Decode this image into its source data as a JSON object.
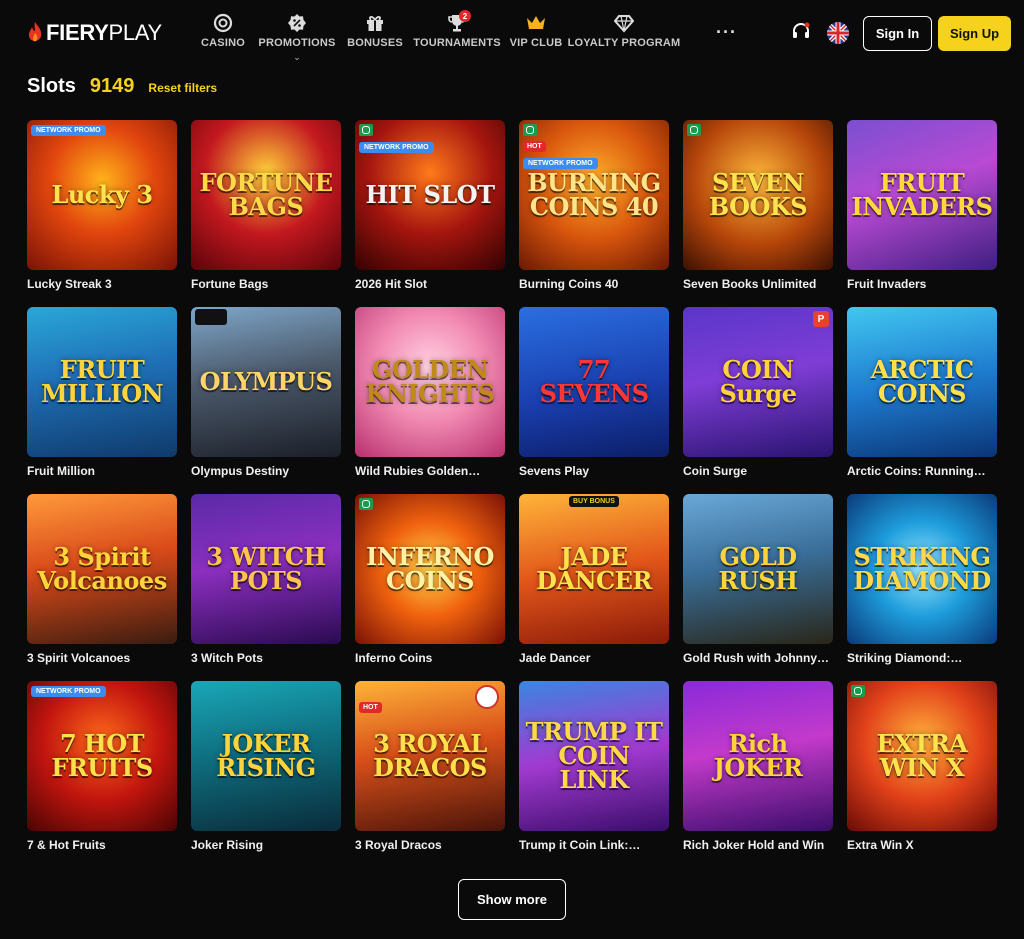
{
  "brand": {
    "part1": "FIERY",
    "part2": "PLAY"
  },
  "nav": [
    {
      "label": "CASINO",
      "icon": "casino-chip-icon"
    },
    {
      "label": "PROMOTIONS",
      "icon": "percent-badge-icon"
    },
    {
      "label": "BONUSES",
      "icon": "gift-icon"
    },
    {
      "label": "TOURNAMENTS",
      "icon": "trophy-icon",
      "badge": "2"
    },
    {
      "label": "VIP CLUB",
      "icon": "crown-icon"
    },
    {
      "label": "LOYALTY PROGRAM",
      "icon": "diamond-icon"
    }
  ],
  "header": {
    "more": "···",
    "sign_in": "Sign In",
    "sign_up": "Sign Up"
  },
  "colors": {
    "accent": "#f6d21c",
    "background": "#0a0a0a",
    "network_tag": "#3c8cf0",
    "hot_tag": "#e02a2a"
  },
  "page": {
    "title": "Slots",
    "count": "9149",
    "reset": "Reset filters"
  },
  "games": [
    {
      "name": "Lucky Streak 3",
      "art": "Lucky 3",
      "tags": {
        "network": "NETWORK PROMO"
      },
      "bg": "radial-gradient(circle at 50% 40%, #ffb21a 0%, #e2460e 45%, #7a1206 100%)",
      "fg": "#ffe24d"
    },
    {
      "name": "Fortune Bags",
      "art": "FORTUNE BAGS",
      "tags": {},
      "bg": "radial-gradient(circle at 50% 35%, #ffcf3a 0%, #c3181f 50%, #5a0409 100%)",
      "fg": "#ffd84a"
    },
    {
      "name": "2026 Hit Slot",
      "art": "HIT SLOT",
      "tags": {
        "network": "NETWORK PROMO",
        "prov": true
      },
      "bg": "radial-gradient(circle at 50% 35%, #ff7a1a 0%, #a5150f 50%, #320202 100%)",
      "fg": "#f3f3f3"
    },
    {
      "name": "Burning Coins 40",
      "art": "BURNING COINS 40",
      "tags": {
        "prov": true,
        "hot": "HOT",
        "network": "NETWORK PROMO"
      },
      "bg": "radial-gradient(circle at 50% 40%, #ffb02a 0%, #d8560d 50%, #6a1804 100%)",
      "fg": "#ffe58a"
    },
    {
      "name": "Seven Books Unlimited",
      "art": "SEVEN BOOKS",
      "tags": {
        "prov": true
      },
      "bg": "radial-gradient(circle at 50% 40%, #ffb83b 0%, #b6460a 55%, #3b1003 100%)",
      "fg": "#ffe24d"
    },
    {
      "name": "Fruit Invaders",
      "art": "FRUIT INVADERS",
      "tags": {},
      "bg": "linear-gradient(160deg, #7b4fd0 0%, #b94ad4 45%, #3d1f80 100%)",
      "fg": "#ffd93a"
    },
    {
      "name": "Fruit Million",
      "art": "FRUIT MILLION",
      "tags": {},
      "bg": "linear-gradient(170deg, #2aa7d8 0%, #1f6fb6 45%, #0f3a6b 100%)",
      "fg": "#ffd43a"
    },
    {
      "name": "Olympus Destiny",
      "art": "OLYMPUS",
      "tags": {
        "hat": true
      },
      "bg": "linear-gradient(170deg, #7ea6c9 0%, #4c5a6c 45%, #1b1f28 100%)",
      "fg": "#ffd468"
    },
    {
      "name": "Wild Rubies Golden…",
      "art": "GOLDEN KNIGHTS",
      "tags": {},
      "bg": "radial-gradient(circle at 50% 40%, #ffd0e0 0%, #f28bb3 45%, #b8306e 100%)",
      "fg": "#c1891b"
    },
    {
      "name": "Sevens Play",
      "art": "77 SEVENS",
      "tags": {},
      "bg": "linear-gradient(170deg, #2a6fe0 0%, #1a3fb0 55%, #0c1f66 100%)",
      "fg": "#ff3636"
    },
    {
      "name": "Coin Surge",
      "art": "COIN Surge",
      "tags": {
        "corner": "P"
      },
      "bg": "linear-gradient(170deg, #5a36c9 0%, #7f3dd6 45%, #2a1470 100%)",
      "fg": "#ffd23a"
    },
    {
      "name": "Arctic Coins: Running…",
      "art": "ARCTIC COINS",
      "tags": {},
      "bg": "linear-gradient(170deg, #41c7f0 0%, #1f7cd0 50%, #0b3577 100%)",
      "fg": "#ffe04a"
    },
    {
      "name": "3 Spirit Volcanoes",
      "art": "3 Spirit Volcanoes",
      "tags": {},
      "bg": "linear-gradient(170deg, #ff9a3b 0%, #d94a1a 45%, #3a1c10 100%)",
      "fg": "#ffd43a"
    },
    {
      "name": "3 Witch Pots",
      "art": "3 WITCH POTS",
      "tags": {},
      "bg": "linear-gradient(170deg, #5a2aa8 0%, #8b2fbf 45%, #2a0b50 100%)",
      "fg": "#ffc54a"
    },
    {
      "name": "Inferno Coins",
      "art": "INFERNO COINS",
      "tags": {
        "prov": true
      },
      "bg": "radial-gradient(circle at 50% 50%, #ffd34a 0%, #f0620e 45%, #7a1106 100%)",
      "fg": "#fff1a6"
    },
    {
      "name": "Jade Dancer",
      "art": "JADE DANCER",
      "tags": {
        "buy": "BUY BONUS"
      },
      "bg": "linear-gradient(170deg, #ffb43a 0%, #e2561a 50%, #8a1a0a 100%)",
      "fg": "#ffe24d"
    },
    {
      "name": "Gold Rush with Johnny…",
      "art": "GOLD RUSH",
      "tags": {},
      "bg": "linear-gradient(170deg, #6aa8d8 0%, #3a6f9a 45%, #2a2618 100%)",
      "fg": "#ffd43a"
    },
    {
      "name": "Striking Diamond:…",
      "art": "STRIKING DIAMOND",
      "tags": {},
      "bg": "radial-gradient(circle at 50% 50%, #9ae8ff 0%, #1e9ddc 45%, #0a3a7a 100%)",
      "fg": "#ffd84a"
    },
    {
      "name": "7 & Hot Fruits",
      "art": "7 HOT FRUITS",
      "tags": {
        "network": "NETWORK PROMO"
      },
      "bg": "radial-gradient(circle at 50% 40%, #ff6a1a 0%, #c2150f 50%, #4a0404 100%)",
      "fg": "#ffe04a"
    },
    {
      "name": "Joker Rising",
      "art": "JOKER RISING",
      "tags": {},
      "bg": "linear-gradient(170deg, #1aa7b8 0%, #0f6f80 45%, #0a2b3a 100%)",
      "fg": "#ffd43a"
    },
    {
      "name": "3 Royal Dracos",
      "art": "3 ROYAL DRACOS",
      "tags": {
        "hot": "HOT",
        "circle": true
      },
      "bg": "linear-gradient(170deg, #ffb33a 0%, #d9501a 45%, #4a140a 100%)",
      "fg": "#ffe04a"
    },
    {
      "name": "Trump it Coin Link:…",
      "art": "TRUMP IT COIN LINK",
      "tags": {},
      "bg": "linear-gradient(170deg, #3a86e0 0%, #a13ad0 50%, #3a0d6a 100%)",
      "fg": "#ffd84a"
    },
    {
      "name": "Rich Joker Hold and Win",
      "art": "Rich JOKER",
      "tags": {},
      "bg": "linear-gradient(170deg, #8a2ad8 0%, #c33acb 45%, #3a0d6a 100%)",
      "fg": "#ffd43a"
    },
    {
      "name": "Extra Win X",
      "art": "EXTRA WIN X",
      "tags": {
        "prov": true
      },
      "bg": "radial-gradient(circle at 50% 40%, #ffb13a 0%, #e2421a 50%, #6a0a06 100%)",
      "fg": "#ffe24d"
    }
  ],
  "show_more": "Show more"
}
